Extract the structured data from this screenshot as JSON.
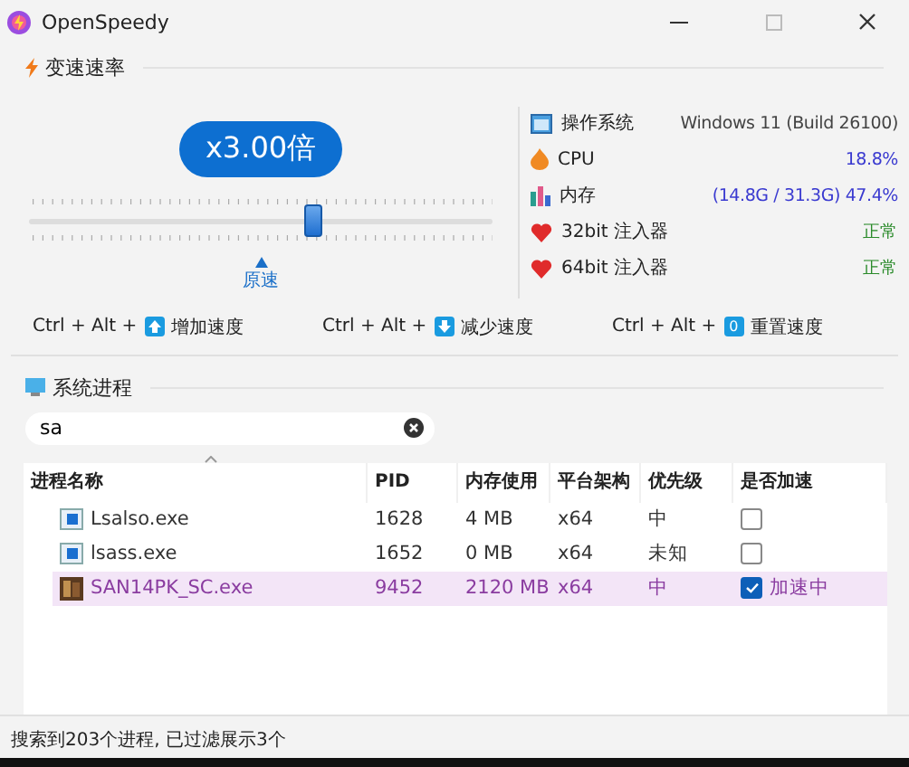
{
  "window": {
    "title": "OpenSpeedy"
  },
  "speed": {
    "title": "变速速率",
    "badge": "x3.00倍",
    "level": 0.61,
    "marker_label": "原速"
  },
  "system_info": [
    {
      "kind": "os",
      "label": "操作系统",
      "value": "Windows 11 (Build 26100)"
    },
    {
      "kind": "cpu",
      "label": "CPU",
      "value": "18.8%"
    },
    {
      "kind": "memory",
      "label": "内存",
      "value": "(14.8G / 31.3G) 47.4%"
    },
    {
      "kind": "injector",
      "label": "32bit 注入器",
      "value": "正常"
    },
    {
      "kind": "injector",
      "label": "64bit 注入器",
      "value": "正常"
    }
  ],
  "hotkeys": [
    {
      "kind": "up",
      "combo": "Ctrl + Alt +",
      "action": "增加速度"
    },
    {
      "kind": "down",
      "combo": "Ctrl + Alt +",
      "action": "减少速度"
    },
    {
      "kind": "zero",
      "key": "0",
      "combo": "Ctrl + Alt +",
      "action": "重置速度"
    }
  ],
  "processes": {
    "title": "系统进程",
    "search": {
      "value": "sa"
    },
    "columns": [
      "进程名称",
      "PID",
      "内存使用",
      "平台架构",
      "优先级",
      "是否加速"
    ],
    "rows": [
      {
        "kind": "system",
        "name": "Lsalso.exe",
        "pid": "1628",
        "memory": "4 MB",
        "arch": "x64",
        "priority": "中",
        "checked": false,
        "selected": false
      },
      {
        "kind": "system",
        "name": "lsass.exe",
        "pid": "1652",
        "memory": "0 MB",
        "arch": "x64",
        "priority": "未知",
        "checked": false,
        "selected": false
      },
      {
        "kind": "game",
        "name": "SAN14PK_SC.exe",
        "pid": "9452",
        "memory": "2120 MB",
        "arch": "x64",
        "priority": "中",
        "checked": true,
        "status": "加速中",
        "selected": true
      }
    ]
  },
  "status_bar": "搜索到203个进程, 已过滤展示3个"
}
